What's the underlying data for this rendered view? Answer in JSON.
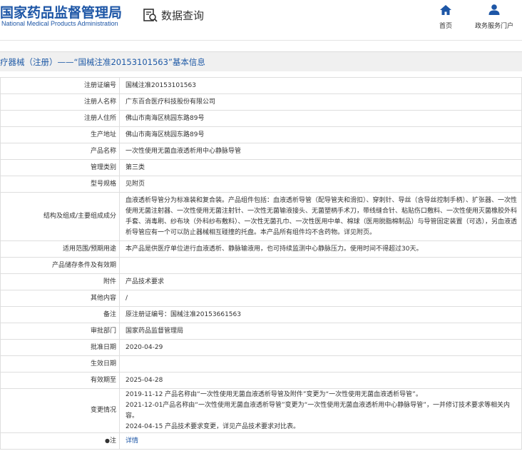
{
  "header": {
    "logo_cn": "国家药品监督管理局",
    "logo_en": "National Medical Products Administration",
    "query_label": "数据查询",
    "nav_home": "首页",
    "nav_portal": "政务服务门户"
  },
  "colors": {
    "brand": "#1d56a6",
    "title_bar_bg": "#f0f0f0",
    "border": "#dedede"
  },
  "title": "疗器械（注册）——“国械注准20153101563”基本信息",
  "rows": [
    {
      "label": "注册证编号",
      "value": "国械注准20153101563"
    },
    {
      "label": "注册人名称",
      "value": "广东百合医疗科技股份有限公司"
    },
    {
      "label": "注册人住所",
      "value": "佛山市南海区桃园东路89号"
    },
    {
      "label": "生产地址",
      "value": "佛山市南海区桃园东路89号"
    },
    {
      "label": "产品名称",
      "value": "一次性使用无菌血液透析用中心静脉导管"
    },
    {
      "label": "管理类别",
      "value": "第三类"
    },
    {
      "label": "型号规格",
      "value": "见附页"
    },
    {
      "label": "结构及组成/主要组成成分",
      "value": "血液透析导管分为标准装和复合装。产品组件包括：血液透析导管（配导管夹和滑扣）、穿刺针、导丝（含导丝控制手柄）、扩张器、一次性使用无菌注射器、一次性使用无菌注射针、一次性无菌输液接头、无菌塑柄手术刀，带线缝合针、粘贴伤口敷料、一次性使用灭菌橡胶外科手套、消毒刷、纱布块（外科纱布敷料）、一次性无菌孔巾、一次性医用中单、棉球（医用脱脂棉制品）与导管固定装置（可选），另血液透析导管应有一个可以防止器械相互碰撞的托盘。本产品所有组件均不含药物。详见附页。"
    },
    {
      "label": "适用范围/预期用途",
      "value": "本产品是供医疗单位进行血液透析、静脉输液用，也可持续监测中心静脉压力。使用时间不得超过30天。"
    },
    {
      "label": "产品储存条件及有效期",
      "value": ""
    },
    {
      "label": "附件",
      "value": "产品技术要求"
    },
    {
      "label": "其他内容",
      "value": "/"
    },
    {
      "label": "备注",
      "value": "原注册证编号：国械注准20153661563"
    },
    {
      "label": "审批部门",
      "value": "国家药品监督管理局"
    },
    {
      "label": "批准日期",
      "value": "2020-04-29"
    },
    {
      "label": "生效日期",
      "value": ""
    },
    {
      "label": "有效期至",
      "value": "2025-04-28"
    }
  ],
  "change_row": {
    "label": "变更情况",
    "lines": [
      "2019-11-12 产品名称由“一次性使用无菌血液透析导管及附件”变更为“一次性使用无菌血液透析导管”。",
      "2021-12-01产品名称由“一次性使用无菌血液透析导管”变更为“一次性使用无菌血液透析用中心静脉导管”，一并修订技术要求等相关内容。",
      "2024-04-15 产品技术要求变更，详见产品技术要求对比表。"
    ]
  },
  "note_row": {
    "label": "注",
    "value": "详情"
  }
}
